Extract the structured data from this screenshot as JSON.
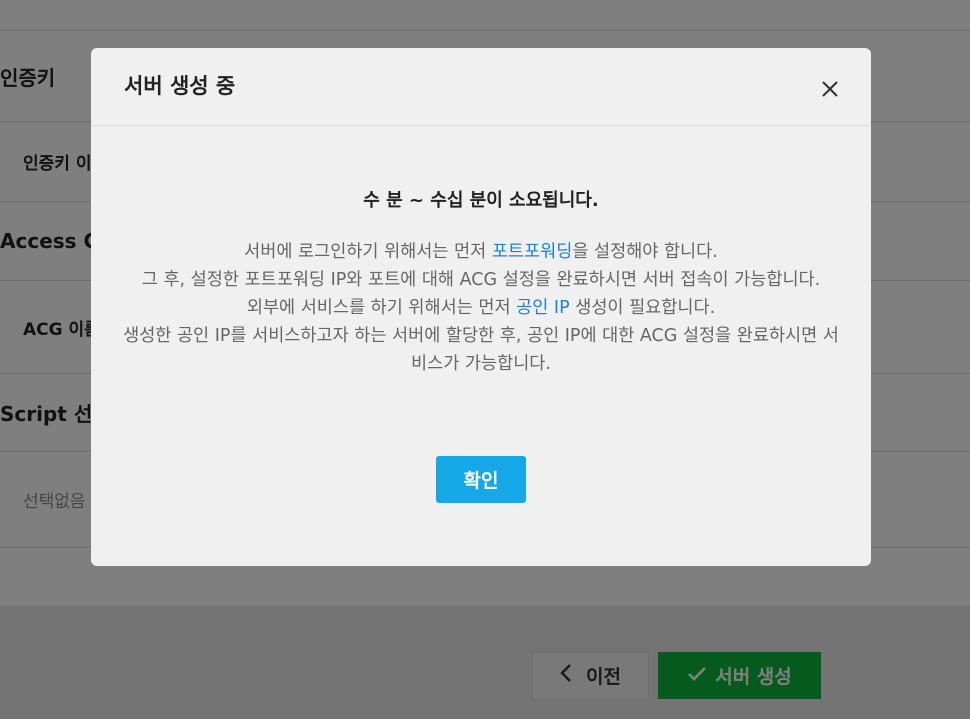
{
  "background": {
    "sections": [
      {
        "text": "인증키"
      },
      {
        "text": "인증키 이"
      },
      {
        "text": "Access Co"
      },
      {
        "text": "ACG 이름"
      },
      {
        "text": "Script 선택"
      },
      {
        "text": "선택없음"
      }
    ],
    "footer": {
      "prev_label": "이전",
      "create_label": "서버 생성"
    }
  },
  "modal": {
    "title": "서버 생성 중",
    "lead": "수 분 ~ 수십 분이 소요됩니다.",
    "line1_pre": "서버에 로그인하기 위해서는 먼저 ",
    "line1_link": "포트포워딩",
    "line1_post": "을 설정해야 합니다.",
    "line2": "그 후, 설정한 포트포워딩 IP와 포트에 대해 ACG 설정을 완료하시면 서버 접속이 가능합니다.",
    "line3_pre": "외부에 서비스를 하기 위해서는 먼저 ",
    "line3_link": "공인 IP",
    "line3_post": " 생성이 필요합니다.",
    "line4": "생성한 공인 IP를 서비스하고자 하는 서버에 할당한 후, 공인 IP에 대한 ACG 설정을 완료하시면 서비스가 가능합니다.",
    "confirm_label": "확인"
  },
  "colors": {
    "link": "#1b82d4",
    "confirm": "#16a8e6",
    "create": "#0fb53a"
  },
  "icons": {
    "close": "close-icon",
    "prev": "chevron-left-icon",
    "create": "check-icon"
  }
}
